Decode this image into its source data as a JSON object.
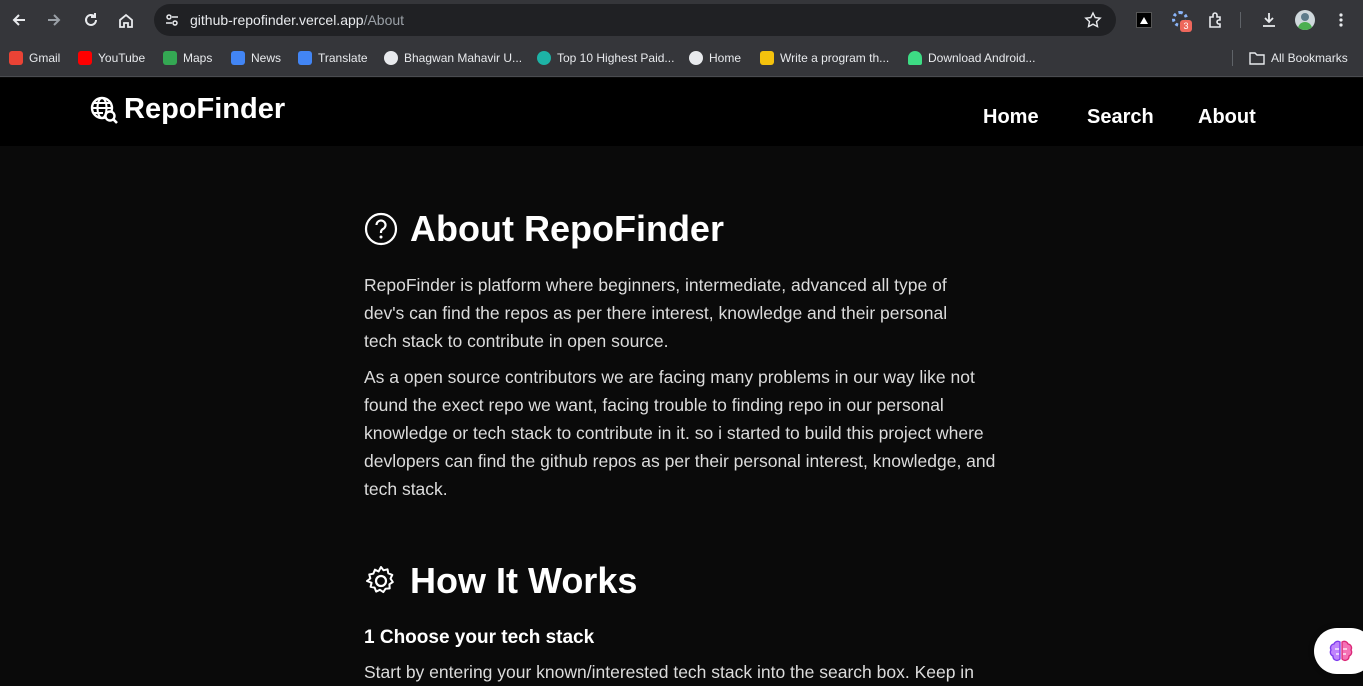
{
  "browser": {
    "url_host": "github-repofinder.vercel.app",
    "url_path": "/About",
    "extension_badge": "3",
    "bookmarks": [
      {
        "label": "Gmail",
        "icon": "gmail-icon",
        "color": "#ea4335"
      },
      {
        "label": "YouTube",
        "icon": "youtube-icon",
        "color": "#ff0000"
      },
      {
        "label": "Maps",
        "icon": "maps-icon",
        "color": "#34a853"
      },
      {
        "label": "News",
        "icon": "news-icon",
        "color": "#4285f4"
      },
      {
        "label": "Translate",
        "icon": "translate-icon",
        "color": "#4285f4"
      },
      {
        "label": "Bhagwan Mahavir U...",
        "icon": "globe-icon",
        "color": "#e8eaed"
      },
      {
        "label": "Top 10 Highest Paid...",
        "icon": "site-icon",
        "color": "#1db3a6"
      },
      {
        "label": "Home",
        "icon": "globe-icon",
        "color": "#e8eaed"
      },
      {
        "label": "Write a program th...",
        "icon": "site-icon",
        "color": "#f4c20d"
      },
      {
        "label": "Download Android...",
        "icon": "android-icon",
        "color": "#3ddc84"
      }
    ],
    "all_bookmarks": "All Bookmarks"
  },
  "site": {
    "logo": "RepoFinder",
    "nav": [
      "Home",
      "Search",
      "About"
    ]
  },
  "about": {
    "title": "About RepoFinder",
    "p1": "RepoFinder is platform where beginners, intermediate, advanced all type of dev's can find the repos as per there interest, knowledge and their personal tech stack to contribute in open source.",
    "p2": "As a open source contributors we are facing many problems in our way like not found the exect repo we want, facing trouble to finding repo in our personal knowledge or tech stack to contribute in it. so i started to build this project where devlopers can find the github repos as per their personal interest, knowledge, and tech stack."
  },
  "how": {
    "title": "How It Works",
    "step1_title": "1 Choose your tech stack",
    "step1_text": "Start by entering your known/interested tech stack into the search box. Keep in"
  }
}
